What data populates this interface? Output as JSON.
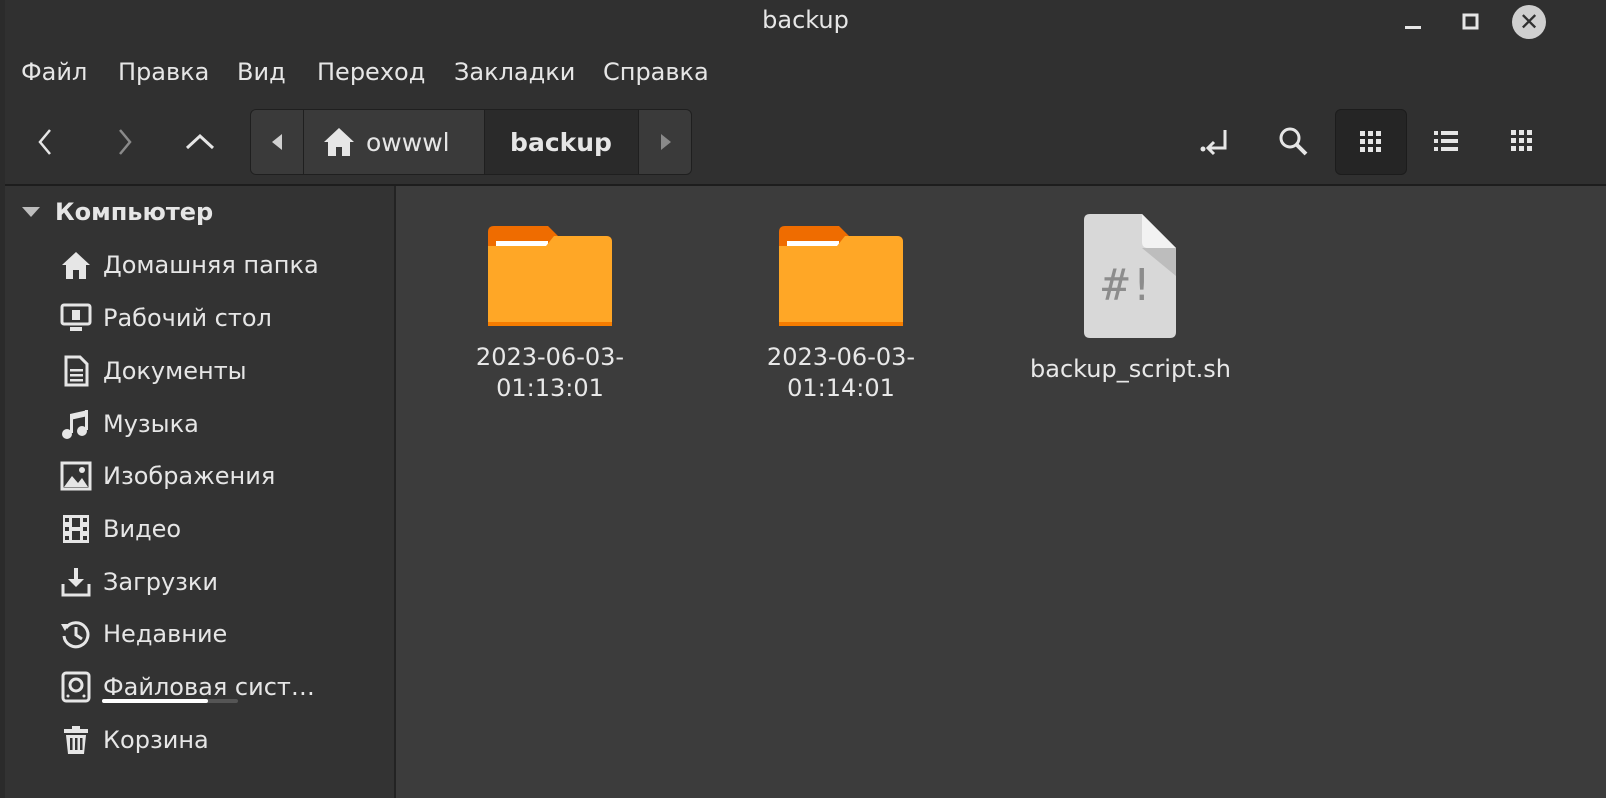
{
  "window": {
    "title": "backup"
  },
  "menu": [
    "Файл",
    "Правка",
    "Вид",
    "Переход",
    "Закладки",
    "Справка"
  ],
  "path": {
    "home_label": "owwwl",
    "current_label": "backup"
  },
  "sidebar": {
    "heading": "Компьютер",
    "items": [
      {
        "label": "Домашняя папка",
        "icon": "home-icon"
      },
      {
        "label": "Рабочий стол",
        "icon": "desktop-icon"
      },
      {
        "label": "Документы",
        "icon": "document-icon"
      },
      {
        "label": "Музыка",
        "icon": "music-icon"
      },
      {
        "label": "Изображения",
        "icon": "image-icon"
      },
      {
        "label": "Видео",
        "icon": "video-icon"
      },
      {
        "label": "Загрузки",
        "icon": "download-icon"
      },
      {
        "label": "Недавние",
        "icon": "recent-icon"
      },
      {
        "label": "Файловая сист…",
        "icon": "drive-icon"
      },
      {
        "label": "Корзина",
        "icon": "trash-icon"
      }
    ]
  },
  "filesystem_usage_fraction": 0.78,
  "files": [
    {
      "name_line1": "2023-06-03-",
      "name_line2": "01:13:01",
      "type": "folder"
    },
    {
      "name_line1": "2023-06-03-",
      "name_line2": "01:14:01",
      "type": "folder"
    },
    {
      "name_line1": "backup_script.sh",
      "name_line2": "",
      "type": "script"
    }
  ],
  "colors": {
    "folder": "#ffa726",
    "folder_tab": "#ef6c00",
    "accent": "#ffffff"
  }
}
